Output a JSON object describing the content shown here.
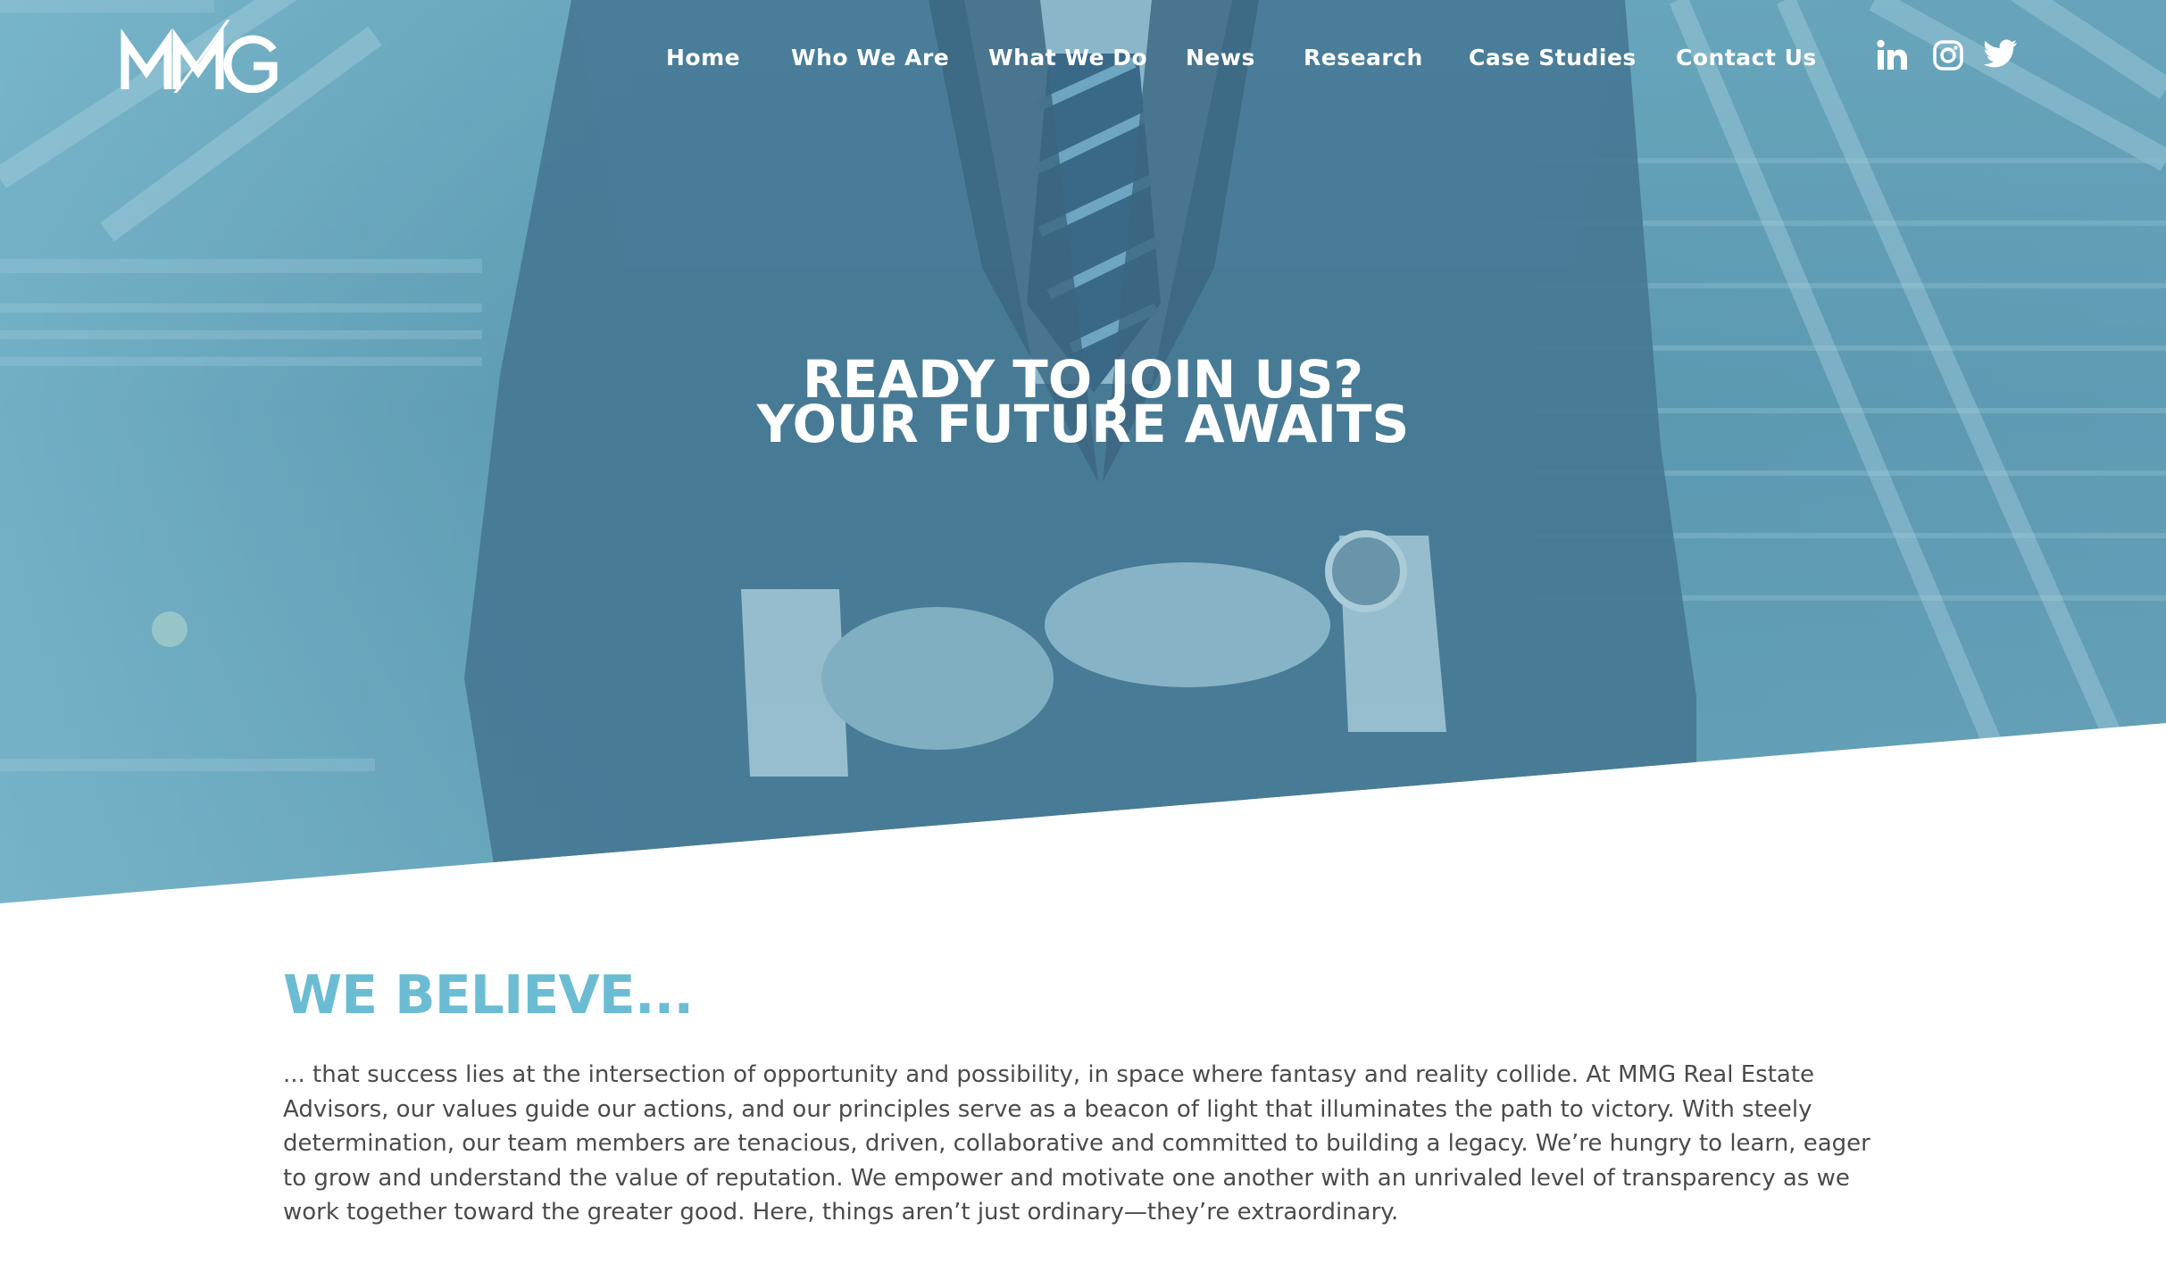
{
  "brand": {
    "logo_text": "MMG"
  },
  "nav": {
    "items": [
      {
        "label": "Home"
      },
      {
        "label": "Who We Are"
      },
      {
        "label": "What We Do"
      },
      {
        "label": "News"
      },
      {
        "label": "Research"
      },
      {
        "label": "Case Studies"
      },
      {
        "label": "Contact Us"
      }
    ]
  },
  "social": {
    "icons": [
      "linkedin-icon",
      "instagram-icon",
      "twitter-icon"
    ]
  },
  "hero": {
    "title_line1": "READY TO JOIN US?",
    "title_line2": "YOUR FUTURE AWAITS"
  },
  "believe": {
    "heading": "WE BELIEVE...",
    "body": "... that success lies at the intersection of opportunity and possibility, in space where fantasy and reality collide. At MMG Real Estate Advisors, our values guide our actions, and our principles serve as a beacon of light that illuminates the path to victory. With steely determination, our team members are tenacious, driven, collaborative and committed to building a legacy. We’re hungry to learn, eager to grow and understand the value of reputation. We empower and motivate one another with an unrivaled level of transparency as we work together toward the greater good. Here, things aren’t just ordinary—they’re extraordinary."
  },
  "colors": {
    "accent": "#6bbcd3",
    "hero_tint": "#5b95ad",
    "body_text": "#4b4b4b"
  }
}
